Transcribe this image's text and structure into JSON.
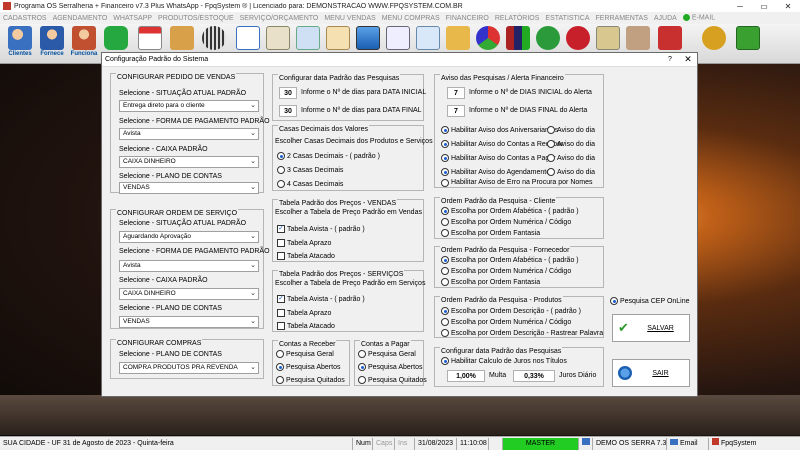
{
  "window": {
    "title": "Programa OS Serralheria + Financeiro v7.3 Plus WhatsApp - FpqSystem ® | Licenciado para: DEMONSTRACAO WWW.FPQSYSTEM.COM.BR"
  },
  "menu": {
    "items": [
      "CADASTROS",
      "AGENDAMENTO",
      "WHATSAPP",
      "PRODUTOS/ESTOQUE",
      "SERVIÇO/ORÇAMENTO",
      "MENU VENDAS",
      "MENU COMPRAS",
      "FINANCEIRO",
      "RELATÓRIOS",
      "ESTATISTICA",
      "FERRAMENTAS",
      "AJUDA"
    ],
    "email": "E-MAIL"
  },
  "toolbar": {
    "labels": [
      "Clientes",
      "Fornece",
      "Funciona"
    ]
  },
  "dialog": {
    "title": "Configuração Padrão do Sistema",
    "help": "?",
    "close": "✕",
    "pedido": {
      "title": "CONFIGURAR PEDIDO DE VENDAS",
      "fields": [
        {
          "label": "Selecione - SITUAÇÃO ATUAL PADRÃO",
          "value": "Entrega direto para o cliente"
        },
        {
          "label": "Selecione - FORMA DE PAGAMENTO PADRÃO",
          "value": "Avista"
        },
        {
          "label": "Selecione - CAIXA PADRÃO",
          "value": "CAIXA DINHEIRO"
        },
        {
          "label": "Selecione - PLANO DE CONTAS",
          "value": "VENDAS"
        }
      ]
    },
    "servico": {
      "title": "CONFIGURAR ORDEM DE SERVIÇO",
      "fields": [
        {
          "label": "Selecione - SITUAÇÃO ATUAL PADRÃO",
          "value": "Aguardando Aprovação"
        },
        {
          "label": "Selecione - FORMA DE PAGAMENTO PADRÃO",
          "value": "Avista"
        },
        {
          "label": "Selecione - CAIXA PADRÃO",
          "value": "CAIXA DINHEIRO"
        },
        {
          "label": "Selecione - PLANO DE CONTAS",
          "value": "VENDAS"
        }
      ]
    },
    "compras": {
      "title": "CONFIGURAR COMPRAS",
      "label": "Selecione - PLANO DE CONTAS",
      "value": "COMPRA PRODUTOS PRA REVENDA"
    },
    "pesquisas": {
      "title": "Configurar data Padrão das Pesquisas",
      "v1": "30",
      "l1": "Informe o Nº de dias para DATA INICIAL",
      "v2": "30",
      "l2": "Informe o Nº de dias para DATA FINAL"
    },
    "decimais": {
      "title": "Casas Decimais dos Valores",
      "subtitle": "Escolher Casas Decimais dos Produtos e Serviços",
      "options": [
        "2 Casas Decimais - ( padrão )",
        "3 Casas Decimais",
        "4 Casas Decimais"
      ]
    },
    "tab_vendas": {
      "title": "Tabela Padrão dos Preços - VENDAS",
      "subtitle": "Escolher a Tabela de Preço Padrão em Vendas",
      "options": [
        "Tabela Avista - ( padrão )",
        "Tabela Aprazo",
        "Tabela Atacado"
      ]
    },
    "tab_servicos": {
      "title": "Tabela Padrão dos Preços - SERVIÇOS",
      "subtitle": "Escolher a Tabela de Preço Padrão em Serviços",
      "options": [
        "Tabela Avista - ( padrão )",
        "Tabela Aprazo",
        "Tabela Atacado"
      ]
    },
    "receber": {
      "title": "Contas a Receber",
      "options": [
        "Pesquisa Geral",
        "Pesquisa Abertos",
        "Pesquisa Quitados"
      ]
    },
    "pagar": {
      "title": "Contas a Pagar",
      "options": [
        "Pesquisa Geral",
        "Pesquisa Abertos",
        "Pesquisa Quitados"
      ]
    },
    "aviso": {
      "title": "Aviso das Pesquisas / Alerta Financeiro",
      "v1": "7",
      "l1": "Informe o Nº de DIAS INICIAL do Alerta",
      "v2": "7",
      "l2": "Informe o Nº de DIAS FINAL do Alerta",
      "rows": [
        [
          "Habilitar Aviso dos Aniversariantes",
          "Aviso do dia"
        ],
        [
          "Habilitar Aviso do Contas a Receber",
          "Aviso do dia"
        ],
        [
          "Habilitar Aviso do Contas a Pagar",
          "Aviso do dia"
        ],
        [
          "Habilitar Aviso do Agendamento",
          "Aviso do dia"
        ]
      ],
      "erro": "Habilitar Aviso de Erro na Procura por Nomes"
    },
    "ord_cliente": {
      "title": "Ordem Padrão da Pesquisa - Cliente",
      "options": [
        "Escolha por Ordem Afabética - ( padrão )",
        "Escolha por Ordem Numérica / Código",
        "Escolha por Ordem Fantasia"
      ]
    },
    "ord_fornecedor": {
      "title": "Ordem Padrão da Pesquisa - Fornecedor",
      "options": [
        "Escolha por Ordem Afabética - ( padrão )",
        "Escolha por Ordem Numérica / Código",
        "Escolha por Ordem Fantasia"
      ]
    },
    "ord_produtos": {
      "title": "Ordem Padrão da Pesquisa - Produtos",
      "options": [
        "Escolha por Ordem Descrição - ( padrão )",
        "Escolha por Ordem Numérica / Código",
        "Escolha por Ordem Descrição - Rastrear Palavra"
      ]
    },
    "juros": {
      "title": "Configurar data Padrão das Pesquisas",
      "check": "Habilitar Calculo de Juros nos Títulos",
      "multa_value": "1,00%",
      "multa_label": "Multa",
      "juros_value": "0,33%",
      "juros_label": "Juros Diário"
    },
    "cep": "Pesquisa CEP OnLine",
    "salvar": "SALVAR",
    "sair": "SAIR"
  },
  "status": {
    "city": "SUA CIDADE - UF 31 de Agosto de 2023 - Quinta-feira",
    "num": "Num",
    "caps": "Caps",
    "ins": "Ins",
    "date": "31/08/2023",
    "time": "11:10:08",
    "master": "MASTER",
    "demo": "DEMO OS SERRA 7.3",
    "email": "Email",
    "brand": "FpqSystem"
  },
  "colors": {
    "accent": "#1a5fd0",
    "master": "#22cc22"
  }
}
